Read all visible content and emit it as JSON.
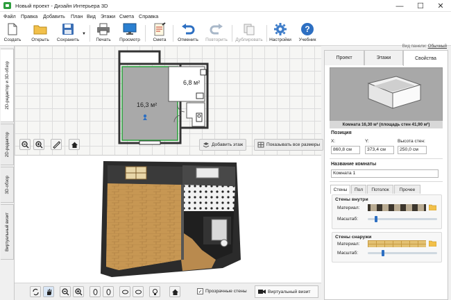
{
  "window": {
    "title": "Новый проект - Дизайн Интерьера 3D",
    "minimize": "—",
    "maximize": "☐",
    "close": "✕"
  },
  "menu": [
    "Файл",
    "Правка",
    "Добавить",
    "План",
    "Вид",
    "Этажи",
    "Смета",
    "Справка"
  ],
  "toolbar": {
    "create": "Создать",
    "open": "Открыть",
    "save": "Сохранить",
    "print": "Печать",
    "preview": "Просмотр",
    "estimate": "Смета",
    "undo": "Отменить",
    "redo": "Повторить",
    "duplicate": "Дублировать",
    "settings": "Настройки",
    "tutorial": "Учебник",
    "panel_mode_label": "Вид панели:",
    "panel_mode_value": "Обычный"
  },
  "side_tabs": [
    "2D-редактор и 3D-обзор",
    "2D-редактор",
    "3D-обзор",
    "Виртуальный визит"
  ],
  "plan": {
    "room1_area": "16,3 м²",
    "room2_area": "6,8 м²",
    "add_floor": "Добавить этаж",
    "show_all_sizes": "Показывать все размеры"
  },
  "view3d": {
    "transparent_walls": "Прозрачные стены",
    "virtual_visit": "Виртуальный визит"
  },
  "right_panel": {
    "tabs": [
      "Проект",
      "Этажи",
      "Свойства"
    ],
    "active_tab": "Свойства",
    "preview_caption": "Комната 16,30 м² (площадь стен 41,90 м²)",
    "position_title": "Позиция",
    "x_label": "X:",
    "x_value": "860,8 см",
    "y_label": "Y:",
    "y_value": "373,4 см",
    "wall_height_label": "Высота стен:",
    "wall_height_value": "250,0 см",
    "room_name_title": "Название комнаты",
    "room_name_value": "Комната 1",
    "sub_tabs": [
      "Стены",
      "Пол",
      "Потолок",
      "Прочее"
    ],
    "walls_inside_title": "Стены внутри",
    "walls_outside_title": "Стены снаружи",
    "material_label": "Материал:",
    "scale_label": "Масштаб:",
    "scale_inside": 0.1,
    "scale_outside": 0.2
  },
  "colors": {
    "accent": "#2d6fc2",
    "floor_wood": "#c99a5a",
    "selection_green": "#27a33a"
  }
}
